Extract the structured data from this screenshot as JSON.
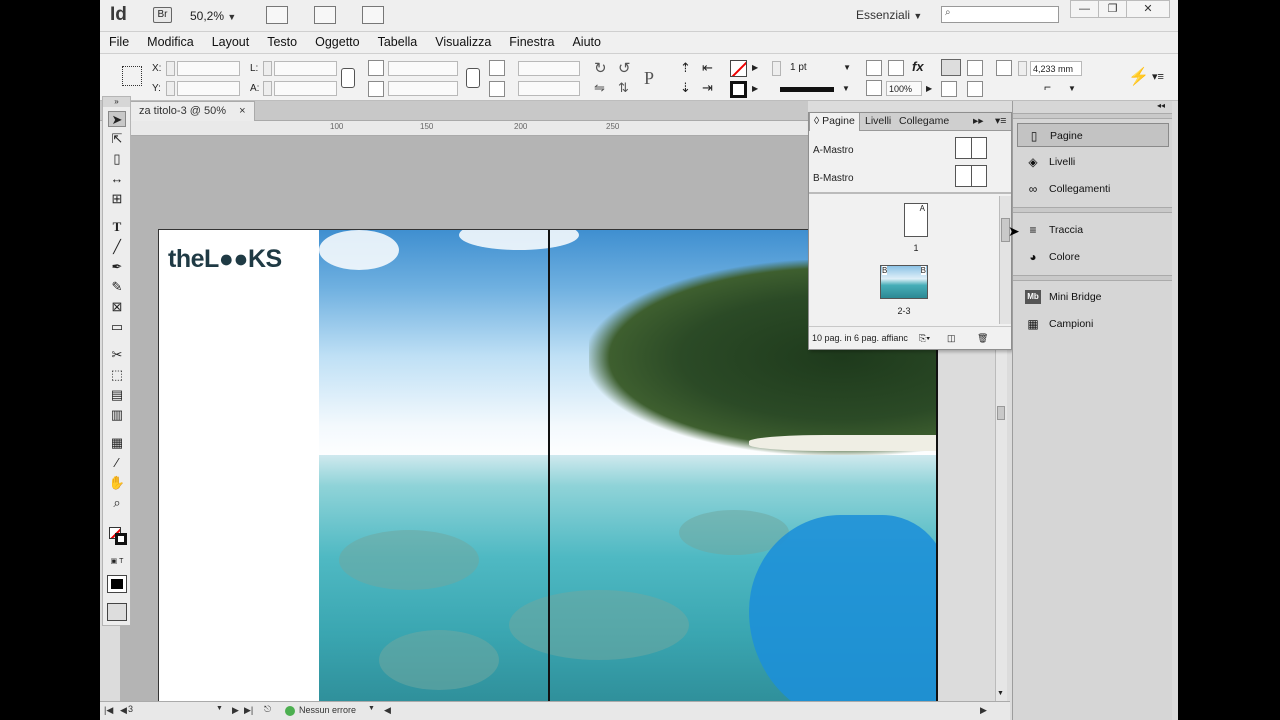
{
  "titlebar": {
    "app_logo": "Id",
    "bridge_label": "Br",
    "zoom_value": "50,2%",
    "workspace": "Essenziali",
    "search_value": "",
    "minimize": "—",
    "restore": "❐",
    "close": "✕"
  },
  "menu": [
    "File",
    "Modifica",
    "Layout",
    "Testo",
    "Oggetto",
    "Tabella",
    "Visualizza",
    "Finestra",
    "Aiuto"
  ],
  "control": {
    "x_label": "X:",
    "y_label": "Y:",
    "l_label": "L:",
    "a_label": "A:",
    "stroke_weight": "1 pt",
    "opacity": "100%",
    "gap_value": "4,233 mm"
  },
  "document": {
    "tab_title": "za titolo-3 @ 50%",
    "tab_close": "×",
    "ruler_marks": [
      "100",
      "150",
      "200",
      "250"
    ],
    "logo_text": "theL●●KS"
  },
  "pages_panel": {
    "tabs": [
      "Pagine",
      "Livelli",
      "Collegame"
    ],
    "masters": [
      "A-Mastro",
      "B-Mastro"
    ],
    "page1_prefix": "A",
    "page1_label": "1",
    "spread_prefix_left": "B",
    "spread_prefix_right": "B",
    "spread_label": "2-3",
    "footer": "10 pag. in 6 pag. affianc"
  },
  "right_dock": {
    "group1": [
      "Pagine",
      "Livelli",
      "Collegamenti"
    ],
    "group2": [
      "Traccia",
      "Colore"
    ],
    "group3": [
      "Mini Bridge",
      "Campioni"
    ]
  },
  "status": {
    "page": "3",
    "preflight": "Nessun errore"
  },
  "colors": {
    "accent_blue": "#1c8fd8",
    "status_ok": "#4caf50"
  }
}
